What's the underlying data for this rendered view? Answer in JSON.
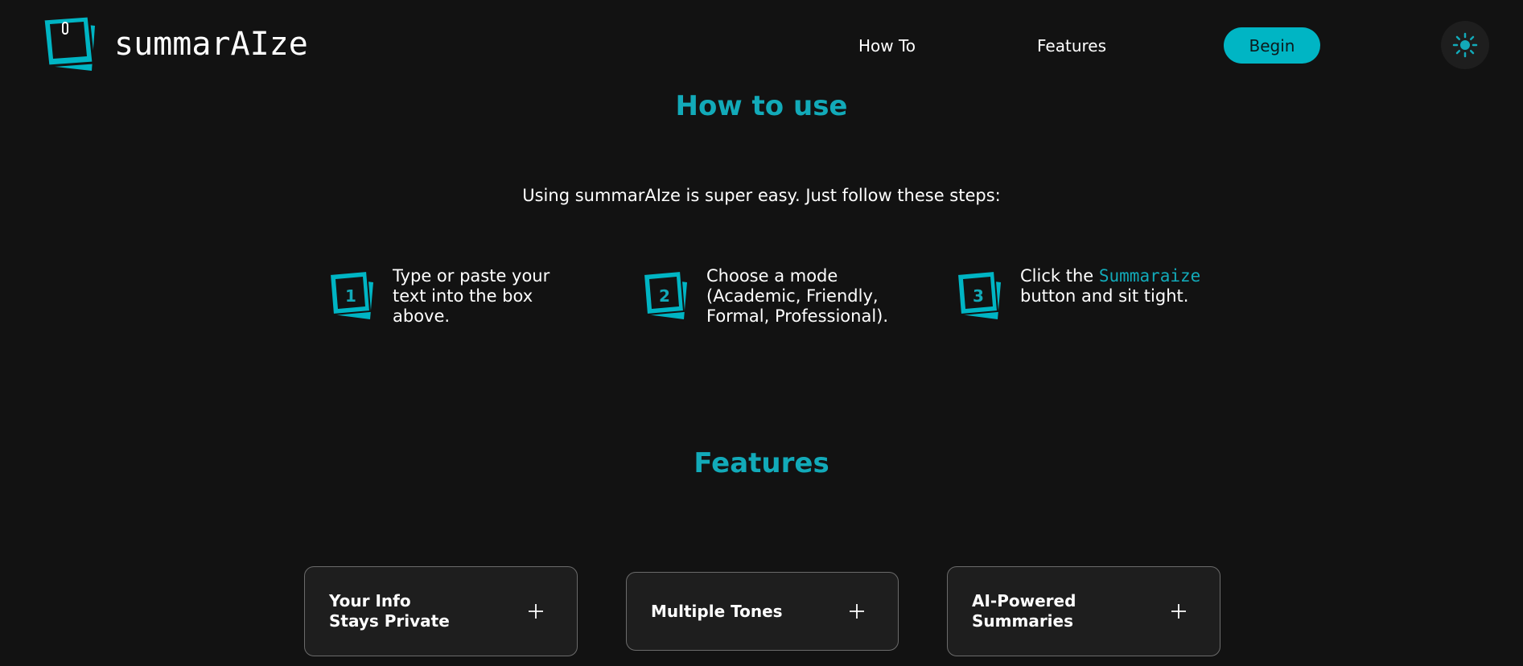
{
  "brand": {
    "name": "summarAIze",
    "accent": "#00b5c4",
    "background": "#121212"
  },
  "nav": {
    "howto_label": "How To",
    "features_label": "Features",
    "begin_label": "Begin",
    "theme_icon": "sun-icon"
  },
  "howto": {
    "title": "How to use",
    "intro": "Using summarAIze is super easy. Just follow these steps:",
    "steps": [
      {
        "number": "1",
        "text": "Type or paste your text into the box above."
      },
      {
        "number": "2",
        "text": "Choose a mode (Academic, Friendly, Formal, Professional)."
      },
      {
        "number": "3",
        "text_before": "Click the",
        "highlight": "Summaraize",
        "text_after": "button and sit tight."
      }
    ]
  },
  "features": {
    "title": "Features",
    "cards": [
      {
        "title": "Your Info Stays Private",
        "icon": "plus-icon"
      },
      {
        "title": "Multiple Tones",
        "icon": "plus-icon"
      },
      {
        "title": "AI-Powered Summaries",
        "icon": "plus-icon"
      }
    ]
  }
}
